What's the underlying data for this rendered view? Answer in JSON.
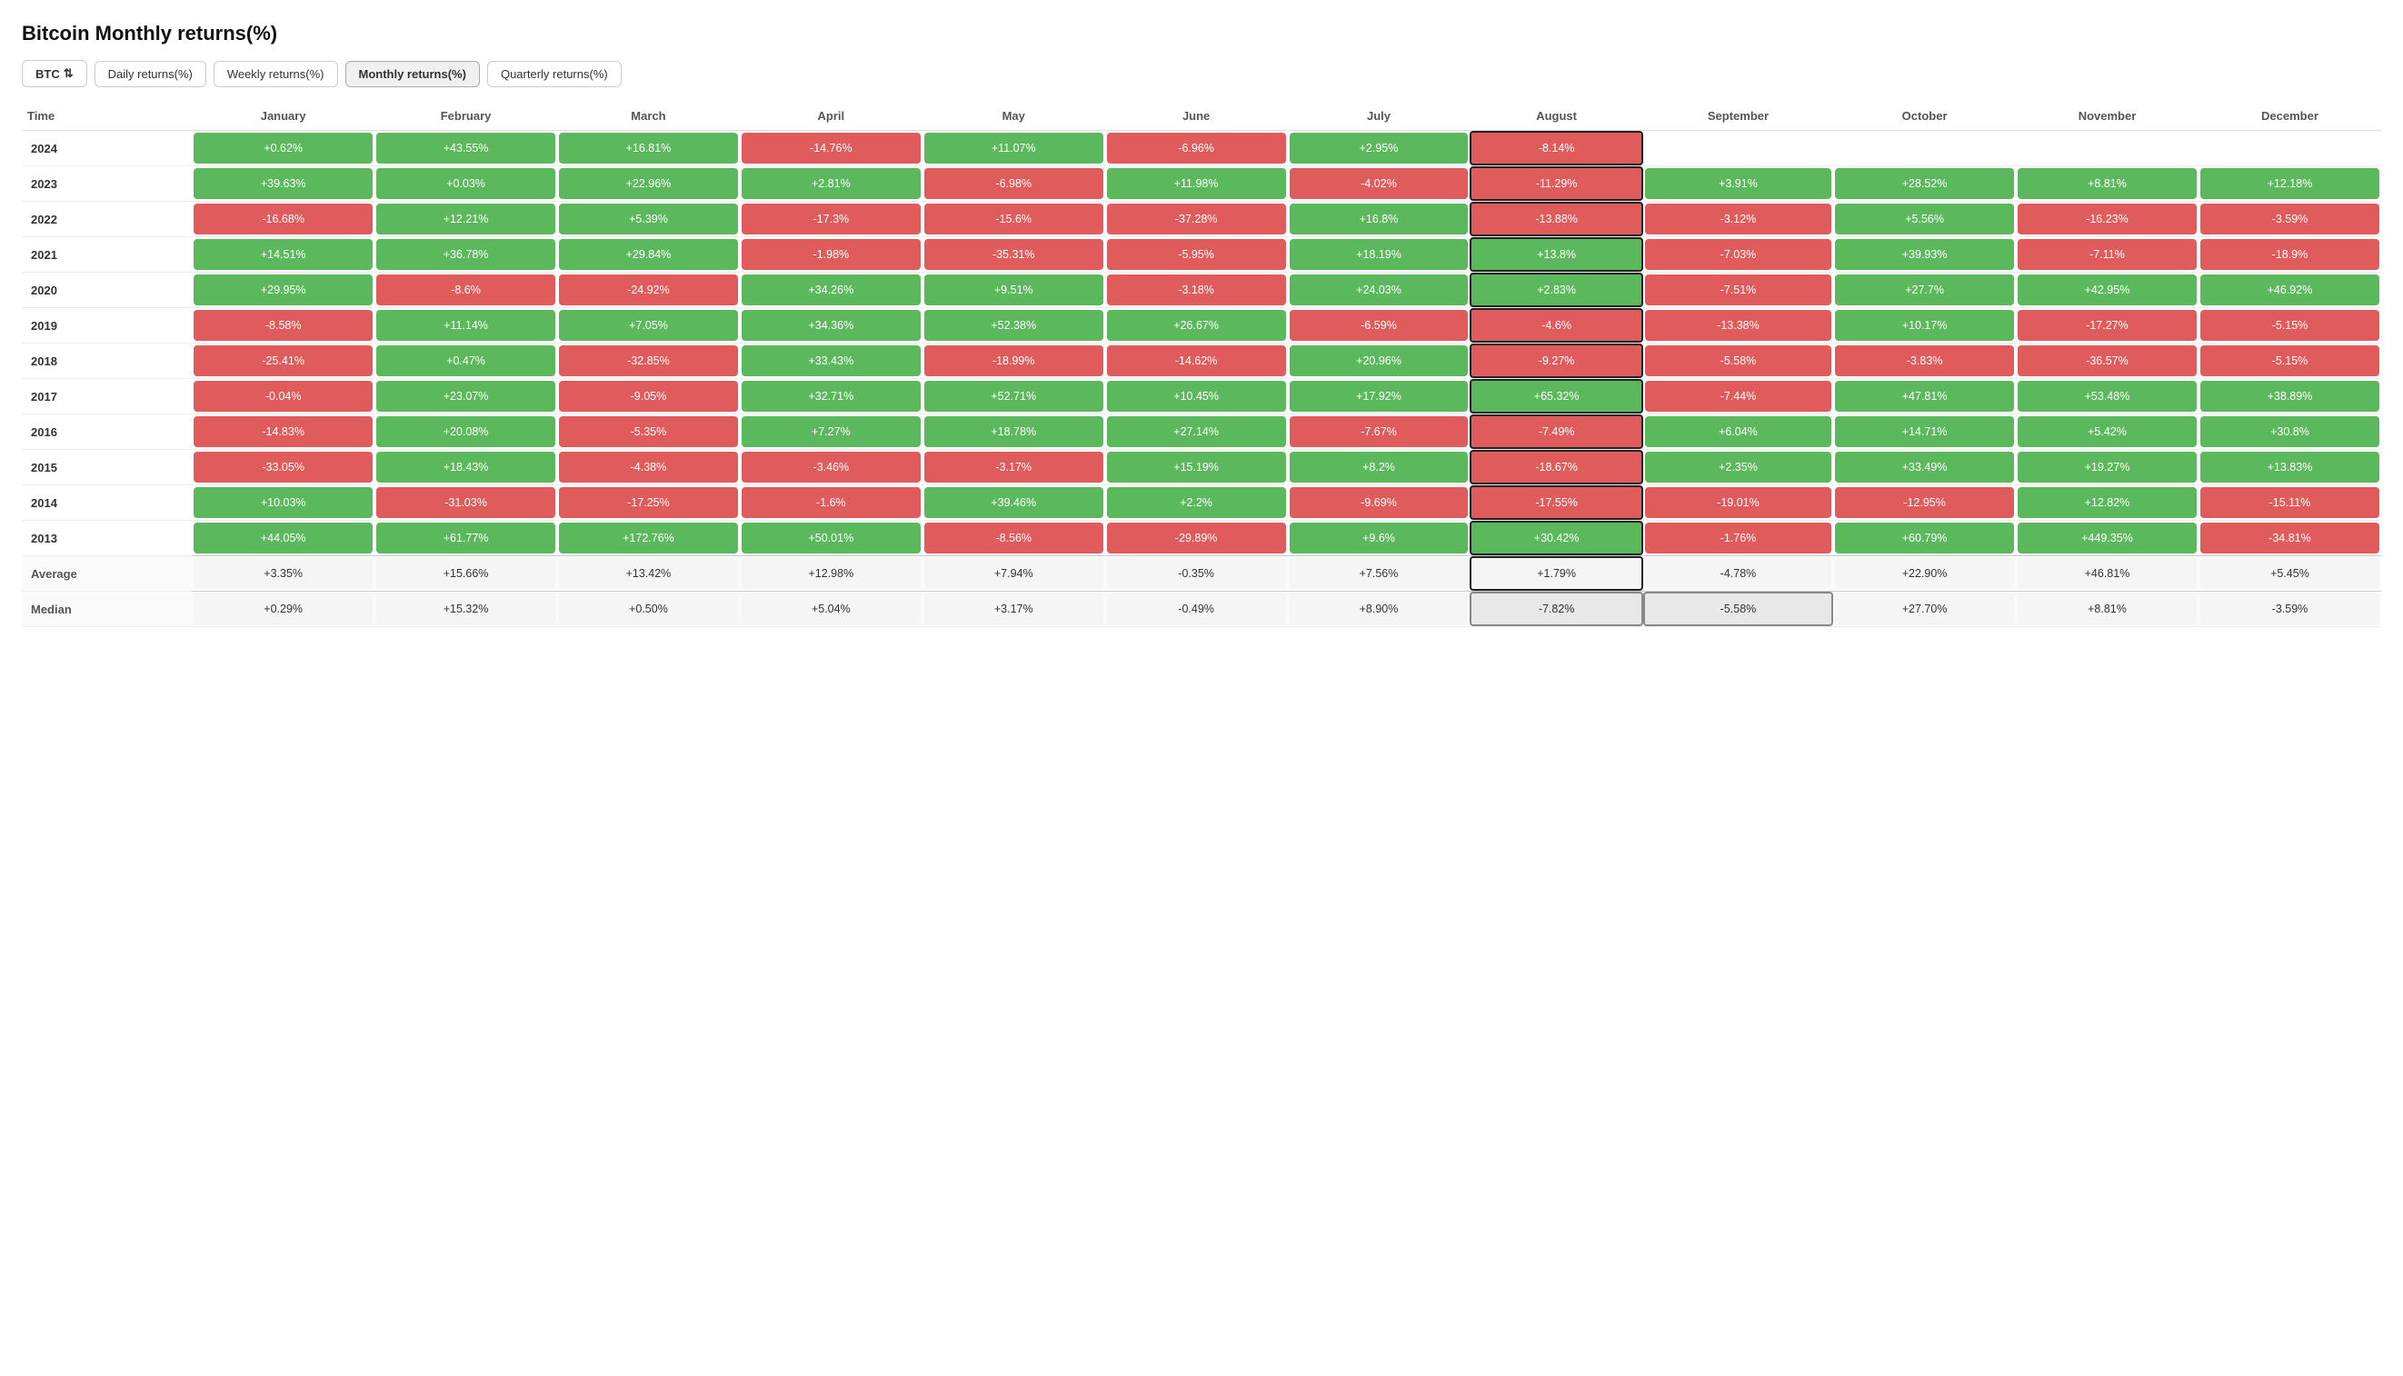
{
  "title": "Bitcoin Monthly returns(%)",
  "toolbar": {
    "asset_label": "BTC",
    "buttons": [
      {
        "id": "daily",
        "label": "Daily returns(%)"
      },
      {
        "id": "weekly",
        "label": "Weekly returns(%)"
      },
      {
        "id": "monthly",
        "label": "Monthly returns(%)",
        "active": true
      },
      {
        "id": "quarterly",
        "label": "Quarterly returns(%)"
      }
    ]
  },
  "columns": [
    "Time",
    "January",
    "February",
    "March",
    "April",
    "May",
    "June",
    "July",
    "August",
    "September",
    "October",
    "November",
    "December"
  ],
  "rows": [
    {
      "year": "2024",
      "values": [
        "+0.62%",
        "+43.55%",
        "+16.81%",
        "-14.76%",
        "+11.07%",
        "-6.96%",
        "+2.95%",
        "-8.14%",
        "",
        "",
        "",
        ""
      ],
      "signs": [
        1,
        1,
        1,
        -1,
        1,
        -1,
        1,
        -1,
        0,
        0,
        0,
        0
      ]
    },
    {
      "year": "2023",
      "values": [
        "+39.63%",
        "+0.03%",
        "+22.96%",
        "+2.81%",
        "-6.98%",
        "+11.98%",
        "-4.02%",
        "-11.29%",
        "+3.91%",
        "+28.52%",
        "+8.81%",
        "+12.18%"
      ],
      "signs": [
        1,
        1,
        1,
        1,
        -1,
        1,
        -1,
        -1,
        1,
        1,
        1,
        1
      ]
    },
    {
      "year": "2022",
      "values": [
        "-16.68%",
        "+12.21%",
        "+5.39%",
        "-17.3%",
        "-15.6%",
        "-37.28%",
        "+16.8%",
        "-13.88%",
        "-3.12%",
        "+5.56%",
        "-16.23%",
        "-3.59%"
      ],
      "signs": [
        -1,
        1,
        1,
        -1,
        -1,
        -1,
        1,
        -1,
        -1,
        1,
        -1,
        -1
      ]
    },
    {
      "year": "2021",
      "values": [
        "+14.51%",
        "+36.78%",
        "+29.84%",
        "-1.98%",
        "-35.31%",
        "-5.95%",
        "+18.19%",
        "+13.8%",
        "-7.03%",
        "+39.93%",
        "-7.11%",
        "-18.9%"
      ],
      "signs": [
        1,
        1,
        1,
        -1,
        -1,
        -1,
        1,
        1,
        -1,
        1,
        -1,
        -1
      ]
    },
    {
      "year": "2020",
      "values": [
        "+29.95%",
        "-8.6%",
        "-24.92%",
        "+34.26%",
        "+9.51%",
        "-3.18%",
        "+24.03%",
        "+2.83%",
        "-7.51%",
        "+27.7%",
        "+42.95%",
        "+46.92%"
      ],
      "signs": [
        1,
        -1,
        -1,
        1,
        1,
        -1,
        1,
        1,
        -1,
        1,
        1,
        1
      ]
    },
    {
      "year": "2019",
      "values": [
        "-8.58%",
        "+11.14%",
        "+7.05%",
        "+34.36%",
        "+52.38%",
        "+26.67%",
        "-6.59%",
        "-4.6%",
        "-13.38%",
        "+10.17%",
        "-17.27%",
        "-5.15%"
      ],
      "signs": [
        -1,
        1,
        1,
        1,
        1,
        1,
        -1,
        -1,
        -1,
        1,
        -1,
        -1
      ]
    },
    {
      "year": "2018",
      "values": [
        "-25.41%",
        "+0.47%",
        "-32.85%",
        "+33.43%",
        "-18.99%",
        "-14.62%",
        "+20.96%",
        "-9.27%",
        "-5.58%",
        "-3.83%",
        "-36.57%",
        "-5.15%"
      ],
      "signs": [
        -1,
        1,
        -1,
        1,
        -1,
        -1,
        1,
        -1,
        -1,
        -1,
        -1,
        -1
      ]
    },
    {
      "year": "2017",
      "values": [
        "-0.04%",
        "+23.07%",
        "-9.05%",
        "+32.71%",
        "+52.71%",
        "+10.45%",
        "+17.92%",
        "+65.32%",
        "-7.44%",
        "+47.81%",
        "+53.48%",
        "+38.89%"
      ],
      "signs": [
        -1,
        1,
        -1,
        1,
        1,
        1,
        1,
        1,
        -1,
        1,
        1,
        1
      ]
    },
    {
      "year": "2016",
      "values": [
        "-14.83%",
        "+20.08%",
        "-5.35%",
        "+7.27%",
        "+18.78%",
        "+27.14%",
        "-7.67%",
        "-7.49%",
        "+6.04%",
        "+14.71%",
        "+5.42%",
        "+30.8%"
      ],
      "signs": [
        -1,
        1,
        -1,
        1,
        1,
        1,
        -1,
        -1,
        1,
        1,
        1,
        1
      ]
    },
    {
      "year": "2015",
      "values": [
        "-33.05%",
        "+18.43%",
        "-4.38%",
        "-3.46%",
        "-3.17%",
        "+15.19%",
        "+8.2%",
        "-18.67%",
        "+2.35%",
        "+33.49%",
        "+19.27%",
        "+13.83%"
      ],
      "signs": [
        -1,
        1,
        -1,
        -1,
        -1,
        1,
        1,
        -1,
        1,
        1,
        1,
        1
      ]
    },
    {
      "year": "2014",
      "values": [
        "+10.03%",
        "-31.03%",
        "-17.25%",
        "-1.6%",
        "+39.46%",
        "+2.2%",
        "-9.69%",
        "-17.55%",
        "-19.01%",
        "-12.95%",
        "+12.82%",
        "-15.11%"
      ],
      "signs": [
        1,
        -1,
        -1,
        -1,
        1,
        1,
        -1,
        -1,
        -1,
        -1,
        1,
        -1
      ]
    },
    {
      "year": "2013",
      "values": [
        "+44.05%",
        "+61.77%",
        "+172.76%",
        "+50.01%",
        "-8.56%",
        "-29.89%",
        "+9.6%",
        "+30.42%",
        "-1.76%",
        "+60.79%",
        "+449.35%",
        "-34.81%"
      ],
      "signs": [
        1,
        1,
        1,
        1,
        -1,
        -1,
        1,
        1,
        -1,
        1,
        1,
        -1
      ]
    }
  ],
  "average": {
    "label": "Average",
    "values": [
      "+3.35%",
      "+15.66%",
      "+13.42%",
      "+12.98%",
      "+7.94%",
      "-0.35%",
      "+7.56%",
      "+1.79%",
      "-4.78%",
      "+22.90%",
      "+46.81%",
      "+5.45%"
    ]
  },
  "median": {
    "label": "Median",
    "values": [
      "+0.29%",
      "+15.32%",
      "+0.50%",
      "+5.04%",
      "+3.17%",
      "-0.49%",
      "+8.90%",
      "-7.82%",
      "-5.58%",
      "+27.70%",
      "+8.81%",
      "-3.59%"
    ]
  },
  "august_col_index": 7,
  "september_col_index": 8
}
